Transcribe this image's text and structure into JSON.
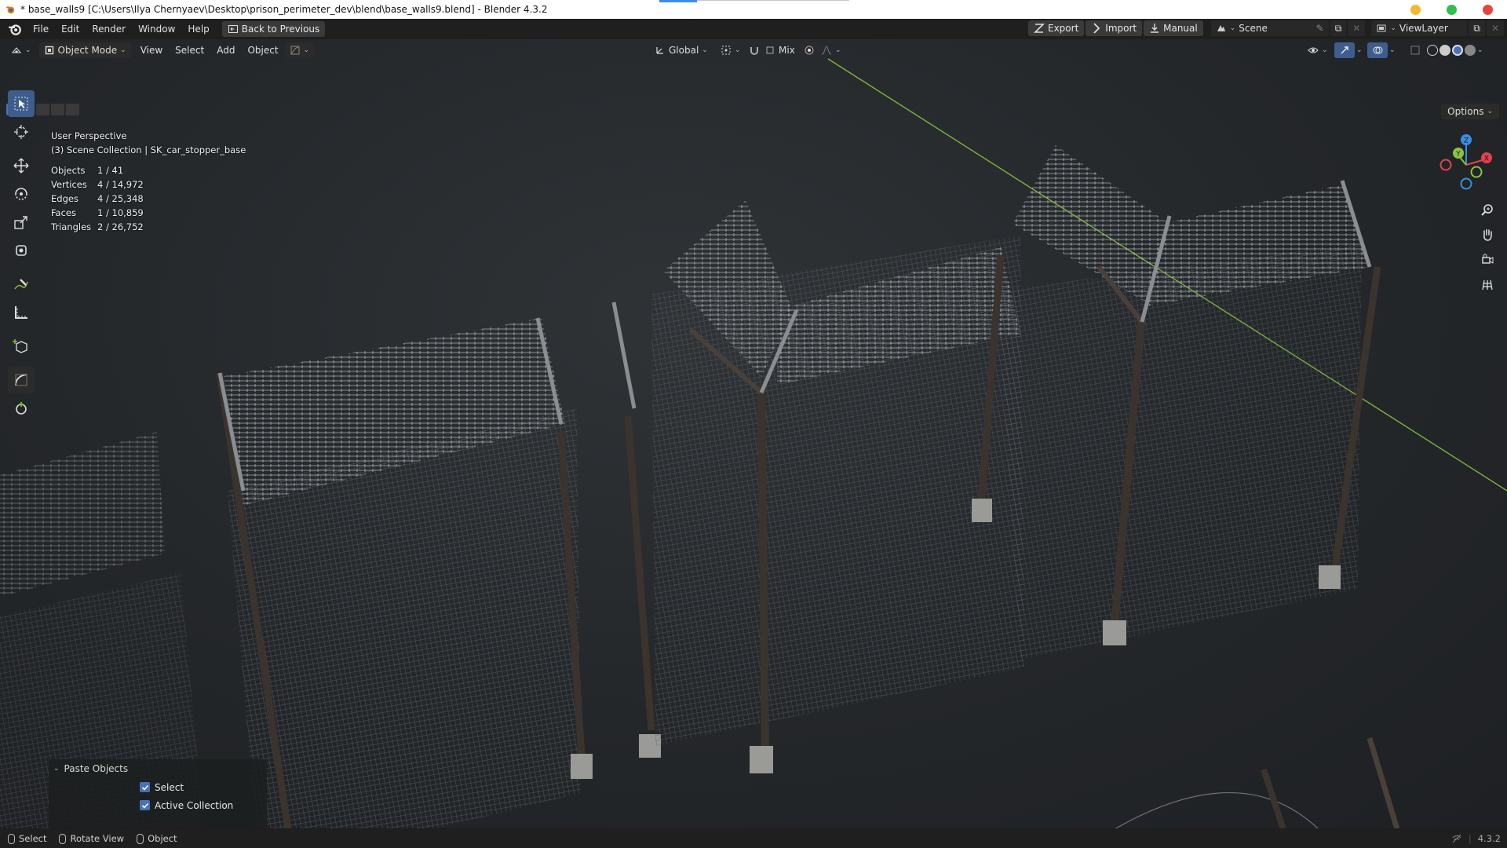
{
  "window": {
    "title": "* base_walls9 [C:\\Users\\Ilya Chernyaev\\Desktop\\prison_perimeter_dev\\blend\\base_walls9.blend] - Blender 4.3.2"
  },
  "topbar": {
    "menus": [
      "File",
      "Edit",
      "Render",
      "Window",
      "Help"
    ],
    "back_button": "Back to Previous",
    "export": "Export",
    "import": "Import",
    "manual": "Manual",
    "scene": "Scene",
    "view_layer": "ViewLayer"
  },
  "viewport_header": {
    "mode": "Object Mode",
    "menus": [
      "View",
      "Select",
      "Add",
      "Object"
    ],
    "transform_orientation": "Global",
    "snap": "Mix",
    "options": "Options"
  },
  "overlay": {
    "view_name": "User Perspective",
    "collection": "(3) Scene Collection | SK_car_stopper_base",
    "stats": [
      {
        "label": "Objects",
        "value": "1 / 41"
      },
      {
        "label": "Vertices",
        "value": "4 / 14,972"
      },
      {
        "label": "Edges",
        "value": "4 / 25,348"
      },
      {
        "label": "Faces",
        "value": "1 / 10,859"
      },
      {
        "label": "Triangles",
        "value": "2 / 26,752"
      }
    ]
  },
  "gizmo": {
    "z": "Z",
    "y": "Y",
    "x": "X"
  },
  "paste_panel": {
    "title": "Paste Objects",
    "select": "Select",
    "active_collection": "Active Collection"
  },
  "statusbar": {
    "select": "Select",
    "rotate": "Rotate View",
    "object": "Object",
    "version": "4.3.2"
  },
  "colors": {
    "accent": "#4772b3",
    "x_axis": "#e0434f",
    "y_axis": "#8bc43f",
    "z_axis": "#3a8fe0"
  }
}
